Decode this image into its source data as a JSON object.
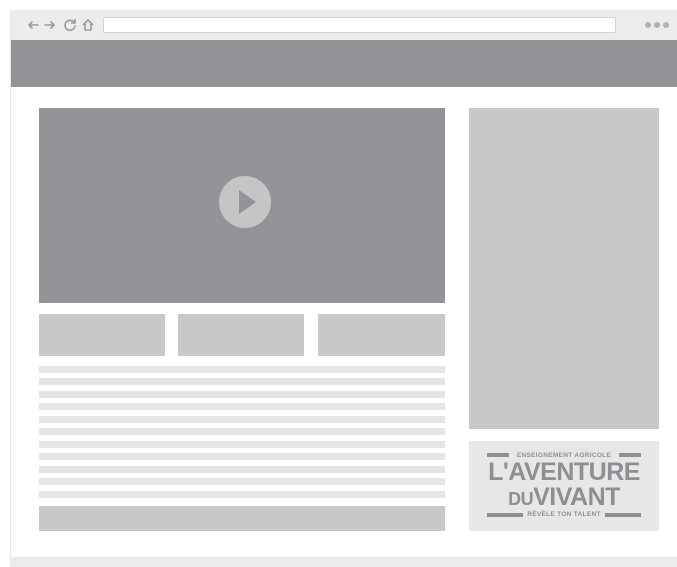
{
  "browser": {
    "address_value": "",
    "icons": [
      "back-arrow-icon",
      "forward-arrow-icon",
      "reload-icon",
      "home-icon",
      "more-dots-icon"
    ]
  },
  "logo": {
    "top_line": "ENSEIGNEMENT AGRICOLE",
    "main_line": "L'AVENTURE",
    "sub_small": "DU",
    "sub_big": "VIVANT",
    "tagline": "RÉVÈLE TON TALENT"
  },
  "colors": {
    "dark_gray": "#939497",
    "mid_gray": "#c7c8ca",
    "light_gray": "#e4e5e6",
    "chrome": "#ececed"
  }
}
